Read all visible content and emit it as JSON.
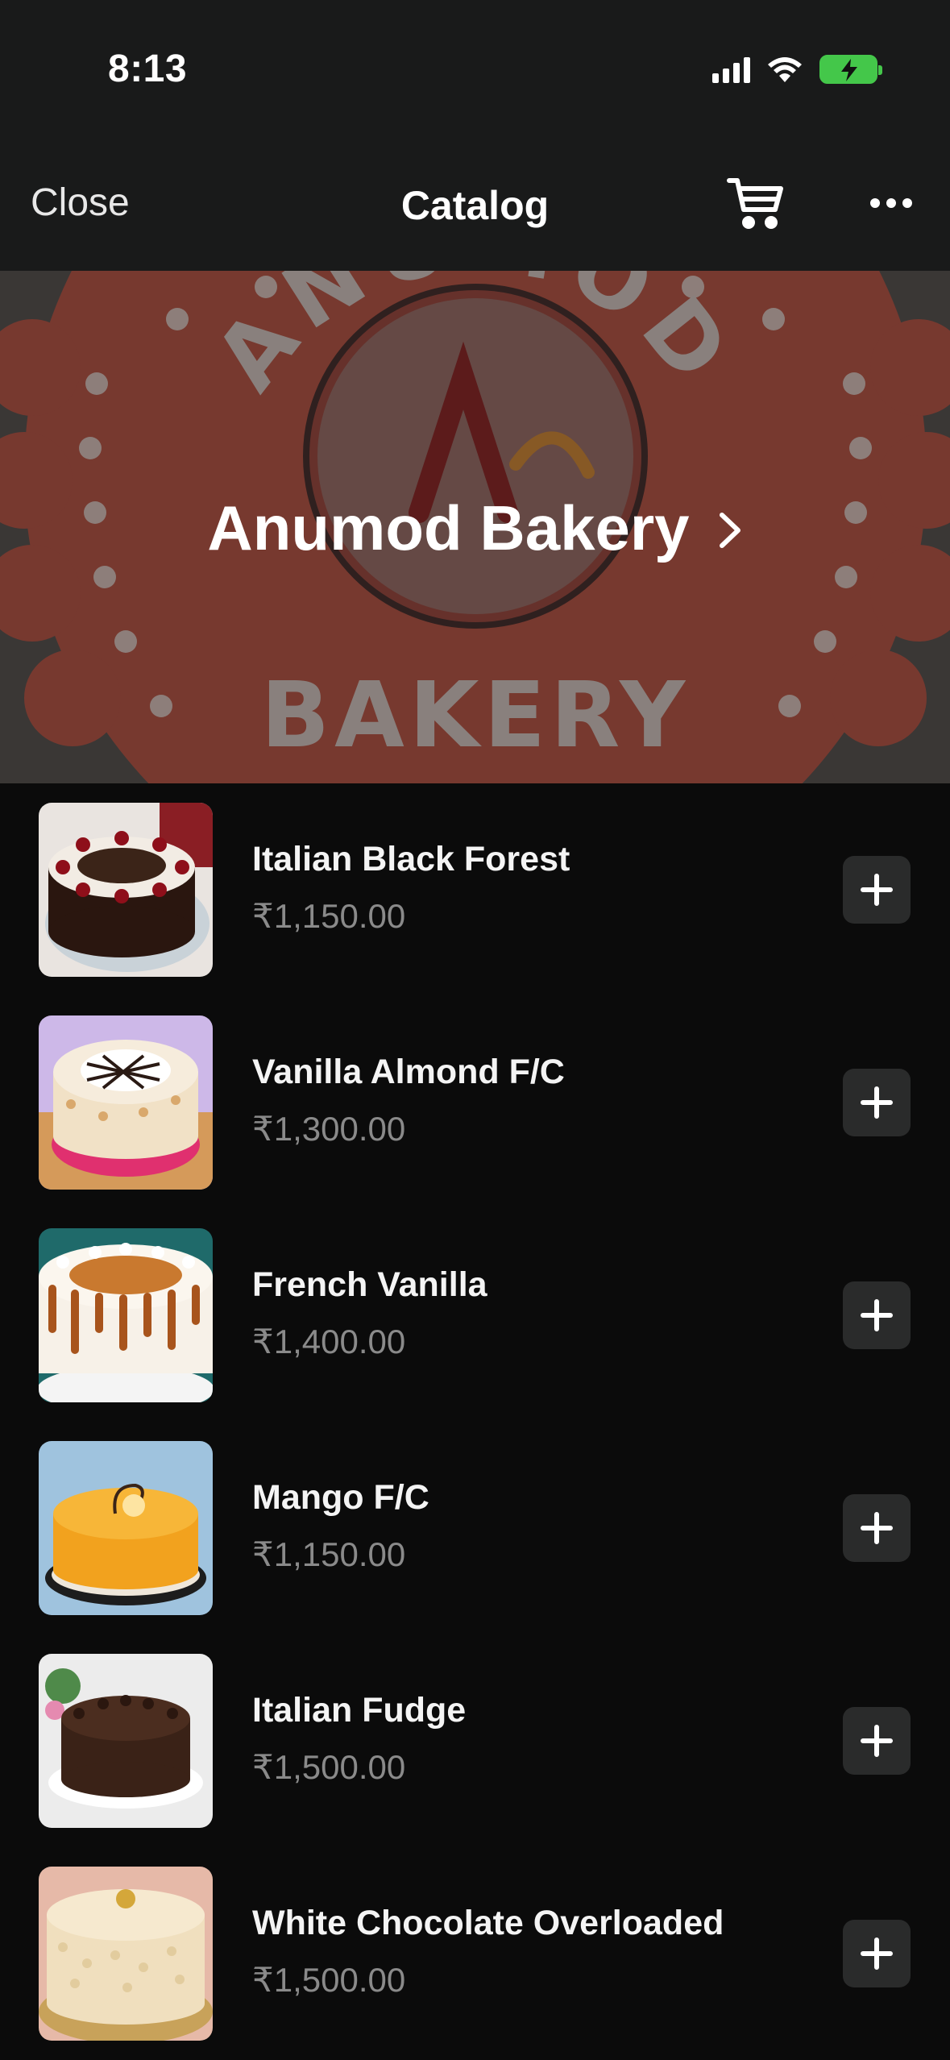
{
  "status_bar": {
    "time": "8:13",
    "icons": [
      "signal-icon",
      "wifi-icon",
      "battery-charging-icon"
    ],
    "battery_color": "#44c74a"
  },
  "nav": {
    "close_label": "Close",
    "title": "Catalog",
    "cart_icon": "cart-icon",
    "more_icon": "more-icon"
  },
  "banner": {
    "business_name": "Anumod Bakery",
    "logo_text_top": "ANUMOD",
    "logo_text_bottom": "BAKERY",
    "logo_color": "#d9432c",
    "chevron_icon": "chevron-right-icon"
  },
  "products": [
    {
      "name": "Italian Black Forest",
      "price": "₹1,150.00",
      "image": "black-forest-cake-photo",
      "accent": "#3b2418"
    },
    {
      "name": "Vanilla Almond F/C",
      "price": "₹1,300.00",
      "image": "vanilla-almond-cake-photo",
      "accent": "#d9a86c"
    },
    {
      "name": "French Vanilla",
      "price": "₹1,400.00",
      "image": "french-vanilla-cake-photo",
      "accent": "#b86b2a"
    },
    {
      "name": "Mango F/C",
      "price": "₹1,150.00",
      "image": "mango-cake-photo",
      "accent": "#f2a21e"
    },
    {
      "name": "Italian Fudge",
      "price": "₹1,500.00",
      "image": "chocolate-fudge-cake-photo",
      "accent": "#3a2217"
    },
    {
      "name": "White Chocolate Overloaded",
      "price": "₹1,500.00",
      "image": "white-chocolate-cake-photo",
      "accent": "#e9d6b0"
    }
  ],
  "add_icon": "plus-icon"
}
